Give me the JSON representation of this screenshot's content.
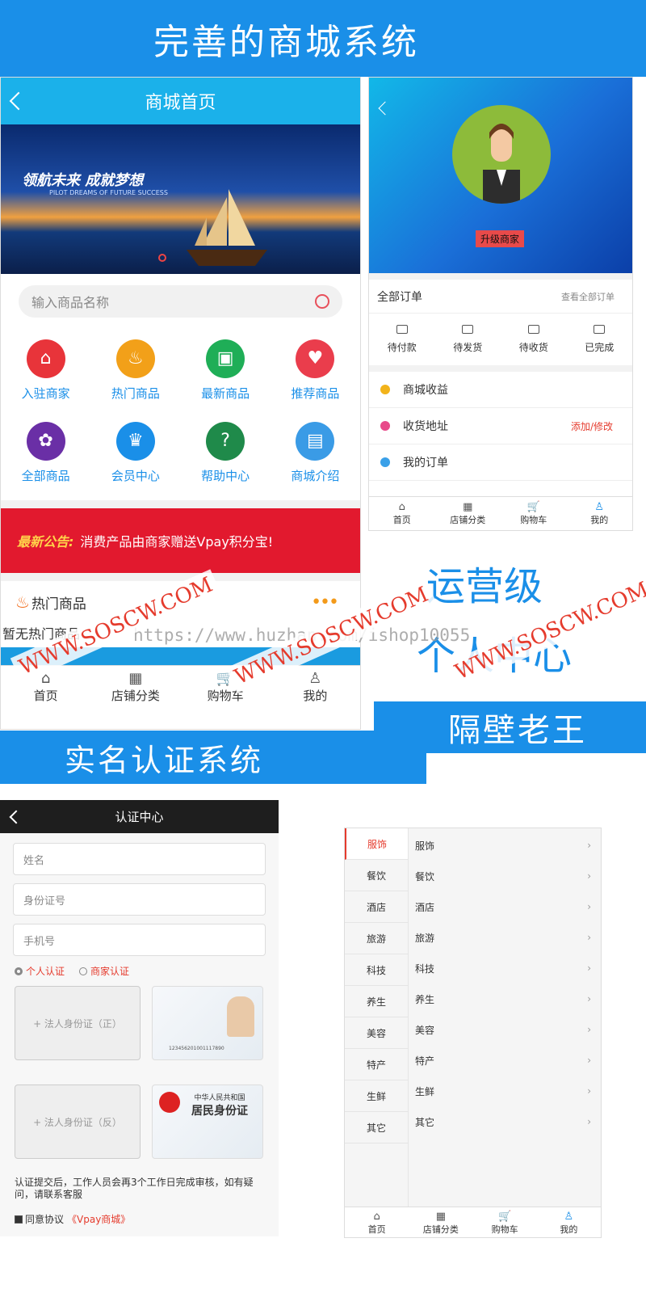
{
  "banners": {
    "top": "完善的商城系统",
    "realname": "实名认证系统",
    "ops": "运营级",
    "personal": "个人中心",
    "laowang": "隔壁老王"
  },
  "watermark": {
    "text": "WWW.SOSCW.COM",
    "url": "https://www.huzhan.com/ishop10055"
  },
  "shop": {
    "title": "商城首页",
    "hero_slogan": "领航未来 成就梦想",
    "hero_sub": "PILOT DREAMS OF FUTURE SUCCESS",
    "search_placeholder": "输入商品名称",
    "grid": [
      {
        "label": "入驻商家",
        "color": "#e8343a",
        "icon": "⌂"
      },
      {
        "label": "热门商品",
        "color": "#f2a019",
        "icon": "♨"
      },
      {
        "label": "最新商品",
        "color": "#1fae57",
        "icon": "▣"
      },
      {
        "label": "推荐商品",
        "color": "#ea3d4c",
        "icon": "♥"
      },
      {
        "label": "全部商品",
        "color": "#6a2fa6",
        "icon": "✿"
      },
      {
        "label": "会员中心",
        "color": "#1a8fe8",
        "icon": "♛"
      },
      {
        "label": "帮助中心",
        "color": "#1f8a4a",
        "icon": "?"
      },
      {
        "label": "商城介绍",
        "color": "#3a9be6",
        "icon": "▤"
      }
    ],
    "notice_label": "最新公告:",
    "notice_text": "消费产品由商家赠送Vpay积分宝!",
    "hot_title": "热门商品",
    "hot_empty": "暂无热门商品",
    "tabs": [
      "首页",
      "店铺分类",
      "购物车",
      "我的"
    ]
  },
  "profile": {
    "badge": "升级商家",
    "orders_title": "全部订单",
    "orders_all": "查看全部订单",
    "order_tabs": [
      "待付款",
      "待发货",
      "待收货",
      "已完成"
    ],
    "rows": [
      {
        "label": "商城收益",
        "extra": ""
      },
      {
        "label": "收货地址",
        "extra": "添加/修改"
      },
      {
        "label": "我的订单",
        "extra": ""
      }
    ],
    "tabs": [
      "首页",
      "店铺分类",
      "购物车",
      "我的"
    ]
  },
  "auth": {
    "title": "认证中心",
    "name_ph": "姓名",
    "id_ph": "身份证号",
    "phone_ph": "手机号",
    "personal": "个人认证",
    "merchant": "商家认证",
    "front": "+ 法人身份证（正）",
    "back": "+ 法人身份证（反）",
    "id_number": "123456201001117890",
    "id_country": "中华人民共和国",
    "id_title": "居民身份证",
    "note": "认证提交后，工作人员会再3个工作日完成审核，如有疑问，请联系客服",
    "agree": "同意协议",
    "agree_link": "《Vpay商城》"
  },
  "category": {
    "left": [
      "服饰",
      "餐饮",
      "酒店",
      "旅游",
      "科技",
      "养生",
      "美容",
      "特产",
      "生鲜",
      "其它"
    ],
    "right": [
      "服饰",
      "餐饮",
      "酒店",
      "旅游",
      "科技",
      "养生",
      "美容",
      "特产",
      "生鲜",
      "其它"
    ],
    "tabs": [
      "首页",
      "店铺分类",
      "购物车",
      "我的"
    ]
  }
}
